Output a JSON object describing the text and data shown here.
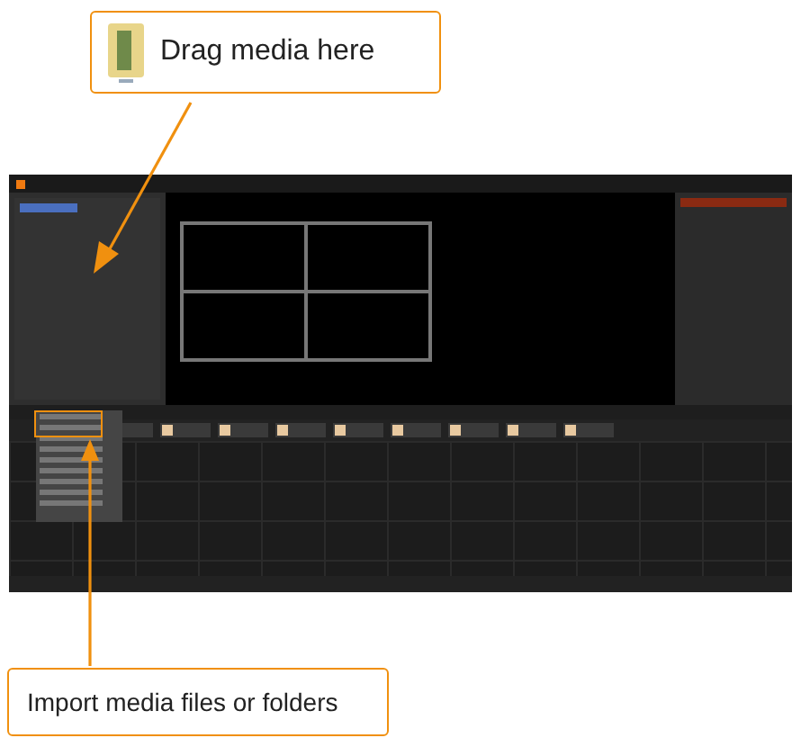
{
  "callouts": [
    {
      "kind": "drag",
      "text": "Drag media here"
    },
    {
      "kind": "import",
      "text": "Import media files or folders"
    }
  ]
}
